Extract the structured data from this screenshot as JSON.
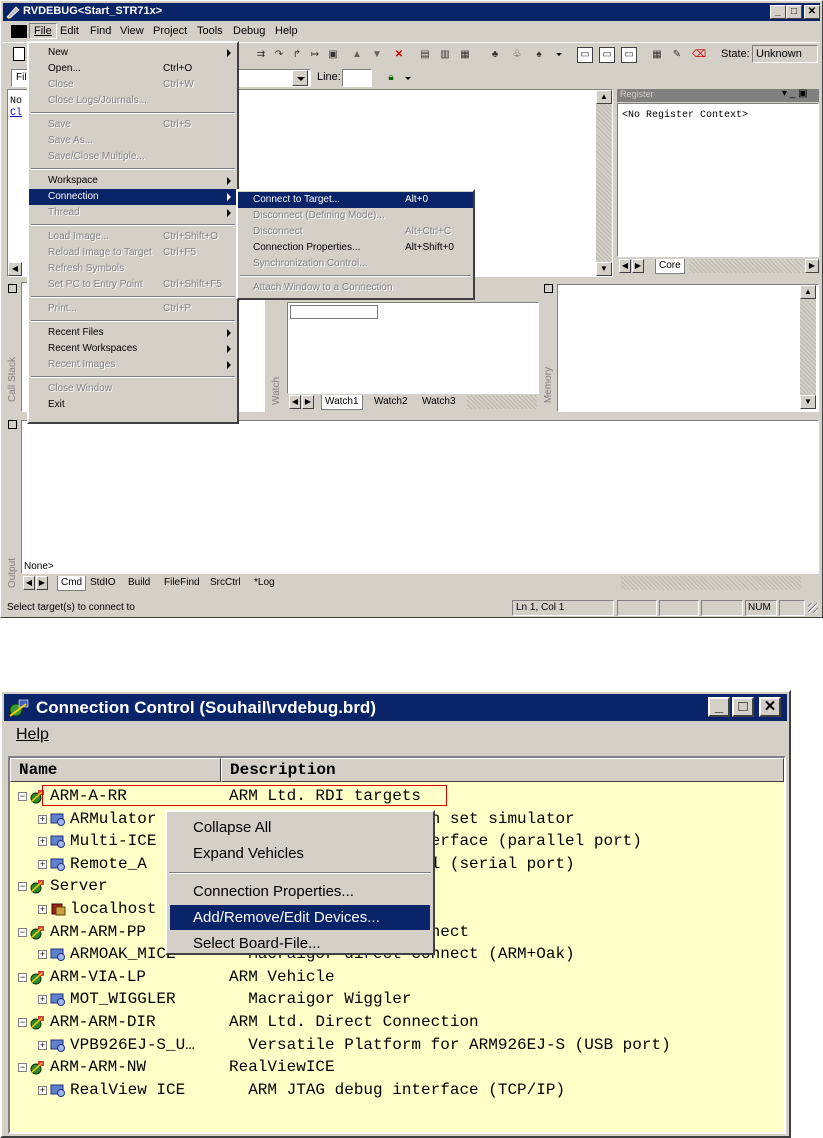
{
  "rvdebug": {
    "title": "RVDEBUG<Start_STR71x>",
    "menubar": [
      "File",
      "Edit",
      "Find",
      "View",
      "Project",
      "Tools",
      "Debug",
      "Help"
    ],
    "state_label": "State:",
    "state_value": "Unknown",
    "line_label": "Line:",
    "file_combo_text": "Fil",
    "code_line1": "No",
    "code_line2": "Cl",
    "register_title": "Register",
    "register_context": "<No Register Context>",
    "register_tabs": [
      "Core"
    ],
    "callstack_label": "Call Stack",
    "watch_label": "Watch",
    "memory_label": "Memory",
    "output_label": "Output",
    "watch_tabs": [
      "Watch1",
      "Watch2",
      "Watch3"
    ],
    "output_text": "None>",
    "output_tabs": [
      "Cmd",
      "StdIO",
      "Build",
      "FileFind",
      "SrcCtrl",
      "Log"
    ],
    "status_text": "Select target(s) to connect to",
    "status_position": "Ln 1, Col 1",
    "status_num": "NUM",
    "file_menu": [
      {
        "label": "New",
        "shortcut": "",
        "submenu": true,
        "disabled": false
      },
      {
        "label": "Open...",
        "shortcut": "Ctrl+O",
        "submenu": false,
        "disabled": false
      },
      {
        "label": "Close",
        "shortcut": "Ctrl+W",
        "submenu": false,
        "disabled": true
      },
      {
        "label": "Close Logs/Journals...",
        "shortcut": "",
        "submenu": false,
        "disabled": true
      },
      {
        "sep": true
      },
      {
        "label": "Save",
        "shortcut": "Ctrl+S",
        "submenu": false,
        "disabled": true
      },
      {
        "label": "Save As...",
        "shortcut": "",
        "submenu": false,
        "disabled": true
      },
      {
        "label": "Save/Close Multiple...",
        "shortcut": "",
        "submenu": false,
        "disabled": true
      },
      {
        "sep": true
      },
      {
        "label": "Workspace",
        "shortcut": "",
        "submenu": true,
        "disabled": false
      },
      {
        "label": "Connection",
        "shortcut": "",
        "submenu": true,
        "disabled": false,
        "selected": true
      },
      {
        "label": "Thread",
        "shortcut": "",
        "submenu": true,
        "disabled": true
      },
      {
        "sep": true
      },
      {
        "label": "Load Image...",
        "shortcut": "Ctrl+Shift+O",
        "submenu": false,
        "disabled": true
      },
      {
        "label": "Reload Image to Target",
        "shortcut": "Ctrl+F5",
        "submenu": false,
        "disabled": true
      },
      {
        "label": "Refresh Symbols",
        "shortcut": "",
        "submenu": false,
        "disabled": true
      },
      {
        "label": "Set PC to Entry Point",
        "shortcut": "Ctrl+Shift+F5",
        "submenu": false,
        "disabled": true
      },
      {
        "sep": true
      },
      {
        "label": "Print...",
        "shortcut": "Ctrl+P",
        "submenu": false,
        "disabled": true
      },
      {
        "sep": true
      },
      {
        "label": "Recent Files",
        "shortcut": "",
        "submenu": true,
        "disabled": false
      },
      {
        "label": "Recent Workspaces",
        "shortcut": "",
        "submenu": true,
        "disabled": false
      },
      {
        "label": "Recent Images",
        "shortcut": "",
        "submenu": true,
        "disabled": true
      },
      {
        "sep": true
      },
      {
        "label": "Close Window",
        "shortcut": "",
        "submenu": false,
        "disabled": true
      },
      {
        "label": "Exit",
        "shortcut": "",
        "submenu": false,
        "disabled": false
      }
    ],
    "connection_menu": [
      {
        "label": "Connect to Target...",
        "shortcut": "Alt+0",
        "disabled": false,
        "selected": true
      },
      {
        "label": "Disconnect (Defining Mode)...",
        "shortcut": "",
        "disabled": true
      },
      {
        "label": "Disconnect",
        "shortcut": "Alt+Ctrl+C",
        "disabled": true
      },
      {
        "label": "Connection Properties...",
        "shortcut": "Alt+Shift+0",
        "disabled": false
      },
      {
        "label": "Synchronization Control...",
        "shortcut": "",
        "disabled": true
      },
      {
        "sep": true
      },
      {
        "label": "Attach Window to a Connection",
        "shortcut": "",
        "disabled": true
      }
    ]
  },
  "connection_control": {
    "title": "Connection Control (Souhail\\rvdebug.brd)",
    "menu_help": "Help",
    "col_name": "Name",
    "col_description": "Description",
    "rows": [
      {
        "name": "ARM-A-RR",
        "desc": "ARM Ltd. RDI targets",
        "level": 0,
        "expander": "−",
        "icon": "target-group-icon",
        "highlight": true
      },
      {
        "name": "ARMulator",
        "desc": "  ARM Ltd. Instruction set simulator",
        "level": 1,
        "expander": "+",
        "icon": "network-icon"
      },
      {
        "name": "Multi-ICE",
        "desc": "  Multi-ICE debug interface (parallel port)",
        "level": 1,
        "expander": "+",
        "icon": "network-icon"
      },
      {
        "name": "Remote_A",
        "desc": "  Angel debug protocol (serial port)",
        "level": 1,
        "expander": "+",
        "icon": "network-icon"
      },
      {
        "name": "Server",
        "desc": "",
        "level": 0,
        "expander": "−",
        "icon": "target-group-icon"
      },
      {
        "name": "localhost",
        "desc": "",
        "level": 1,
        "expander": "+",
        "icon": "server-icon"
      },
      {
        "name": "ARM-ARM-PP",
        "desc": "ARM Ltd. Parallel Connect",
        "level": 0,
        "expander": "−",
        "icon": "target-group-icon"
      },
      {
        "name": "ARMOAK_MICE",
        "desc": "  Macraigor direct connect (ARM+Oak)",
        "level": 1,
        "expander": "+",
        "icon": "network-icon"
      },
      {
        "name": "ARM-VIA-LP",
        "desc": "ARM Vehicle",
        "level": 0,
        "expander": "−",
        "icon": "target-group-icon"
      },
      {
        "name": "MOT_WIGGLER",
        "desc": "  Macraigor Wiggler",
        "level": 1,
        "expander": "+",
        "icon": "network-icon"
      },
      {
        "name": "ARM-ARM-DIR",
        "desc": "ARM Ltd. Direct Connection",
        "level": 0,
        "expander": "−",
        "icon": "target-group-icon"
      },
      {
        "name": "VPB926EJ-S_U…",
        "desc": "  Versatile Platform for ARM926EJ-S (USB port)",
        "level": 1,
        "expander": "+",
        "icon": "network-icon"
      },
      {
        "name": "ARM-ARM-NW",
        "desc": "RealViewICE",
        "level": 0,
        "expander": "−",
        "icon": "target-group-icon"
      },
      {
        "name": "RealView ICE",
        "desc": "  ARM JTAG debug interface (TCP/IP)",
        "level": 1,
        "expander": "+",
        "icon": "network-icon"
      }
    ],
    "context_menu": [
      {
        "label": "Collapse All"
      },
      {
        "label": "Expand Vehicles"
      },
      {
        "sep": true
      },
      {
        "label": "Connection Properties..."
      },
      {
        "label": "Add/Remove/Edit Devices...",
        "selected": true
      },
      {
        "label": "Select Board-File..."
      }
    ]
  },
  "colors": {
    "titlebar_active": "#0a246a",
    "window_face": "#d4d0c8",
    "cc_background": "#ffffc8",
    "highlight_box": "#e00000"
  }
}
